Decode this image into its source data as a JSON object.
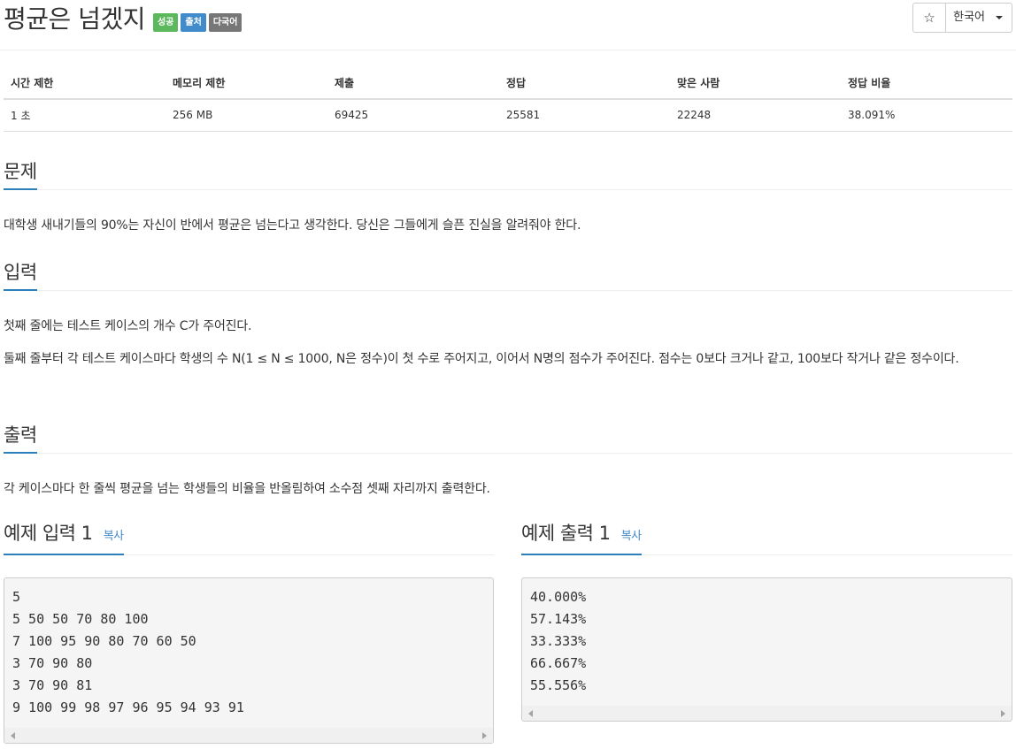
{
  "problem": {
    "title": "평균은 넘겠지",
    "badges": [
      {
        "label": "성공",
        "color": "#5cb85c"
      },
      {
        "label": "출처",
        "color": "#428bca"
      },
      {
        "label": "다국어",
        "color": "#777777"
      }
    ],
    "star_icon": "☆",
    "language": "한국어"
  },
  "stats": {
    "headers": [
      "시간 제한",
      "메모리 제한",
      "제출",
      "정답",
      "맞은 사람",
      "정답 비율"
    ],
    "values": [
      "1 초",
      "256 MB",
      "69425",
      "25581",
      "22248",
      "38.091%"
    ]
  },
  "sections": {
    "problem_title": "문제",
    "problem_text": "대학생 새내기들의 90%는 자신이 반에서 평균은 넘는다고 생각한다. 당신은 그들에게 슬픈 진실을 알려줘야 한다.",
    "input_title": "입력",
    "input_text_1": "첫째 줄에는 테스트 케이스의 개수 C가 주어진다.",
    "input_text_2": "둘째 줄부터 각 테스트 케이스마다 학생의 수 N(1 ≤ N ≤ 1000, N은 정수)이 첫 수로 주어지고, 이어서 N명의 점수가 주어진다. 점수는 0보다 크거나 같고, 100보다 작거나 같은 정수이다.",
    "output_title": "출력",
    "output_text": "각 케이스마다 한 줄씩 평균을 넘는 학생들의 비율을 반올림하여 소수점 셋째 자리까지 출력한다."
  },
  "sample": {
    "input_title": "예제 입력 1",
    "output_title": "예제 출력 1",
    "copy_label": "복사",
    "input_lines": [
      "5",
      "5 50 50 70 80 100",
      "7 100 95 90 80 70 60 50",
      "3 70 90 80",
      "3 70 90 81",
      "9 100 99 98 97 96 95 94 93 91"
    ],
    "output_lines": [
      "40.000%",
      "57.143%",
      "33.333%",
      "66.667%",
      "55.556%"
    ]
  }
}
